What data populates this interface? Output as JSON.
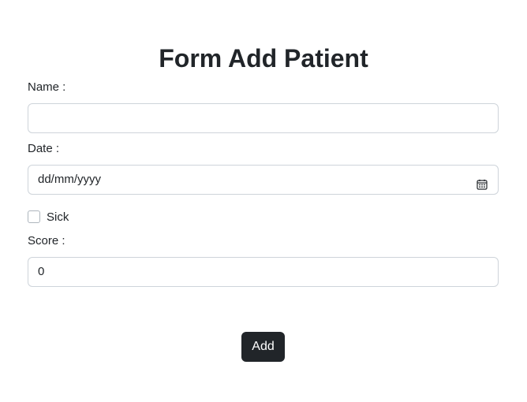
{
  "form": {
    "title": "Form Add Patient",
    "name": {
      "label": "Name :",
      "value": ""
    },
    "date": {
      "label": "Date :",
      "placeholder": "dd/mm/yyyy",
      "icon": "calendar-icon"
    },
    "sick": {
      "label": "Sick",
      "checked": false
    },
    "score": {
      "label": "Score :",
      "value": "0"
    },
    "submit_label": "Add"
  },
  "colors": {
    "button_bg": "#212529",
    "border": "#ced4da",
    "text": "#212529"
  }
}
